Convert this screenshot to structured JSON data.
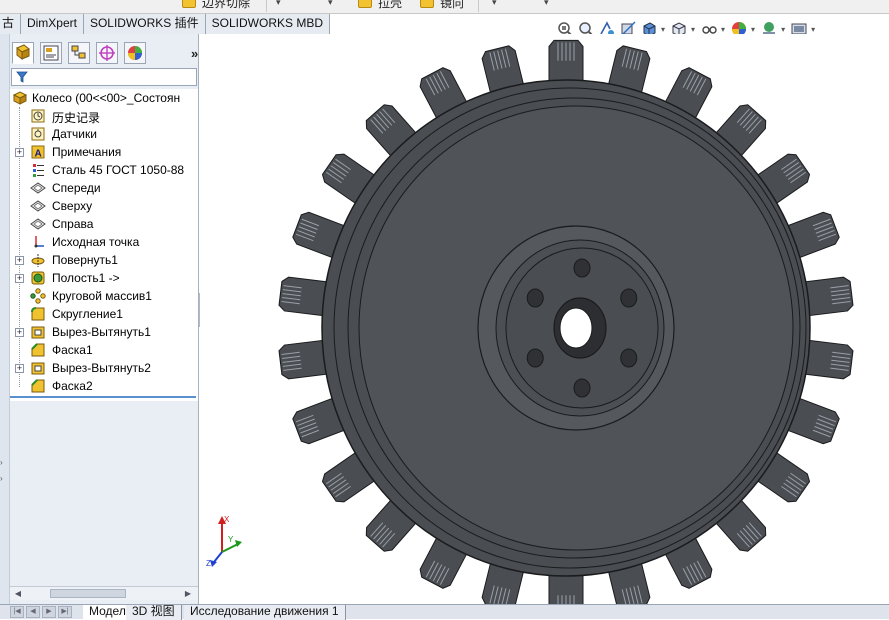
{
  "top_toolbar": {
    "partial_label_1": "边界切除",
    "partial_label_2": "拉壳",
    "partial_label_3": "镜向"
  },
  "command_manager": {
    "tabs": [
      {
        "label": "古"
      },
      {
        "label": "DimXpert"
      },
      {
        "label": "SOLIDWORKS 插件"
      },
      {
        "label": "SOLIDWORKS MBD"
      }
    ]
  },
  "heads_up_toolbar": {
    "icons": [
      "zoom-fit-icon",
      "zoom-area-icon",
      "previous-view-icon",
      "section-view-icon",
      "view-orientation-icon",
      "display-style-icon",
      "hide-show-icon",
      "appearance-icon",
      "scene-icon",
      "view-settings-icon"
    ]
  },
  "feature_manager": {
    "tabs": [
      "feature-tree-tab",
      "property-manager-tab",
      "configuration-manager-tab",
      "dimxpert-manager-tab",
      "display-manager-tab"
    ],
    "root": "Колесо  (00<<00>_Состоян",
    "items": [
      {
        "label": "历史记录",
        "icon": "history-icon",
        "expandable": false
      },
      {
        "label": "Датчики",
        "icon": "sensors-icon",
        "expandable": false
      },
      {
        "label": "Примечания",
        "icon": "annotations-icon",
        "expandable": true
      },
      {
        "label": "Сталь 45 ГОСТ 1050-88",
        "icon": "material-icon",
        "expandable": false
      },
      {
        "label": "Спереди",
        "icon": "plane-icon",
        "expandable": false
      },
      {
        "label": "Сверху",
        "icon": "plane-icon",
        "expandable": false
      },
      {
        "label": "Справа",
        "icon": "plane-icon",
        "expandable": false
      },
      {
        "label": "Исходная точка",
        "icon": "origin-icon",
        "expandable": false
      },
      {
        "label": "Повернуть1",
        "icon": "revolve-icon",
        "expandable": true
      },
      {
        "label": "Полость1 ->",
        "icon": "cavity-icon",
        "expandable": true
      },
      {
        "label": "Круговой массив1",
        "icon": "circular-pattern-icon",
        "expandable": false
      },
      {
        "label": "Скругление1",
        "icon": "fillet-icon",
        "expandable": false
      },
      {
        "label": "Вырез-Вытянуть1",
        "icon": "extruded-cut-icon",
        "expandable": true
      },
      {
        "label": "Фаска1",
        "icon": "chamfer-icon",
        "expandable": false
      },
      {
        "label": "Вырез-Вытянуть2",
        "icon": "extruded-cut-icon",
        "expandable": true
      },
      {
        "label": "Фаска2",
        "icon": "chamfer-icon",
        "expandable": false
      }
    ]
  },
  "triad": {
    "x": "X",
    "y": "Y",
    "z": "Z"
  },
  "bottom_tabs": [
    {
      "label": "Модель",
      "active": true
    },
    {
      "label": "3D 视图",
      "active": false
    },
    {
      "label": "Исследование движения 1",
      "active": false
    }
  ],
  "colors": {
    "wheel_fill": "#4a4d52",
    "wheel_edge": "#1a1b1d",
    "panel_bg": "#e9eef5",
    "axis_x": "#d02020",
    "axis_y": "#1a9a1a",
    "axis_z": "#2040d0"
  }
}
